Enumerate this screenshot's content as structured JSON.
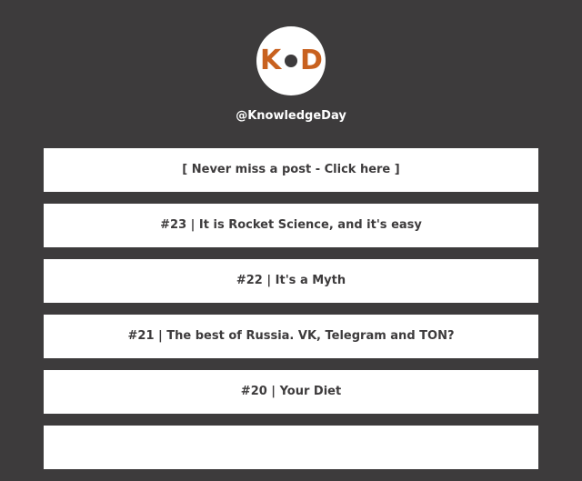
{
  "profile": {
    "logo": {
      "left_letter": "K",
      "right_letter": "D",
      "letter_color": "#c8611f",
      "dot_color": "#3d3b3c"
    },
    "handle": "@KnowledgeDay"
  },
  "colors": {
    "background": "#3d3b3c",
    "button_bg": "#ffffff",
    "button_text": "#3d3b3c"
  },
  "links": [
    {
      "label": "[ Never miss a post - Click here ]"
    },
    {
      "label": "#23 | It is Rocket Science, and it's easy"
    },
    {
      "label": "#22 | It's a Myth"
    },
    {
      "label": "#21 | The best of Russia. VK, Telegram and TON?"
    },
    {
      "label": "#20 | Your Diet"
    },
    {
      "label": ""
    }
  ]
}
